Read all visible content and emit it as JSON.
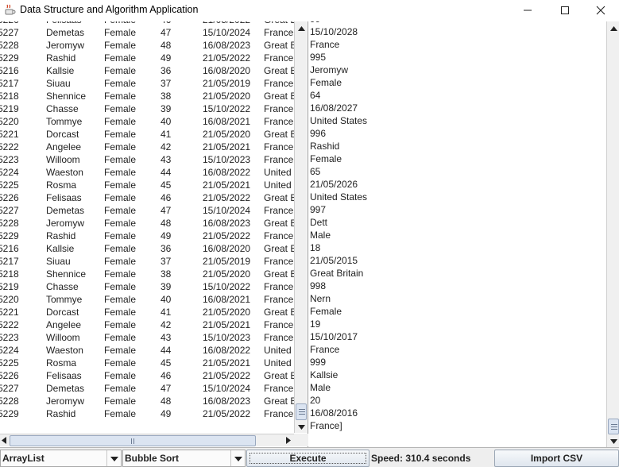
{
  "window": {
    "title": "Data Structure and Algorithm Application",
    "app_icon": "java-coffee-icon",
    "minimize_icon": "minimize-icon",
    "maximize_icon": "maximize-icon",
    "close_icon": "close-icon"
  },
  "left_table": {
    "partial_top_row": {
      "id": "5226",
      "name": "Felisaas",
      "gender": "Female",
      "age": "46",
      "date": "21/05/2022",
      "country": "Great Bri"
    },
    "rows": [
      {
        "id": "5227",
        "name": "Demetas",
        "gender": "Female",
        "age": "47",
        "date": "15/10/2024",
        "country": "France"
      },
      {
        "id": "5228",
        "name": "Jeromyw",
        "gender": "Female",
        "age": "48",
        "date": "16/08/2023",
        "country": "Great B"
      },
      {
        "id": "5229",
        "name": "Rashid",
        "gender": "Female",
        "age": "49",
        "date": "21/05/2022",
        "country": "France"
      },
      {
        "id": "5216",
        "name": "Kallsie",
        "gender": "Female",
        "age": "36",
        "date": "16/08/2020",
        "country": "Great Brit"
      },
      {
        "id": "5217",
        "name": "Siuau",
        "gender": "Female",
        "age": "37",
        "date": "21/05/2019",
        "country": "France"
      },
      {
        "id": "5218",
        "name": "Shennice",
        "gender": "Female",
        "age": "38",
        "date": "21/05/2020",
        "country": "Great B"
      },
      {
        "id": "5219",
        "name": "Chasse",
        "gender": "Female",
        "age": "39",
        "date": "15/10/2022",
        "country": "France"
      },
      {
        "id": "5220",
        "name": "Tommye",
        "gender": "Female",
        "age": "40",
        "date": "16/08/2021",
        "country": "France"
      },
      {
        "id": "5221",
        "name": "Dorcast",
        "gender": "Female",
        "age": "41",
        "date": "21/05/2020",
        "country": "Great Bri"
      },
      {
        "id": "5222",
        "name": "Angelee",
        "gender": "Female",
        "age": "42",
        "date": "21/05/2021",
        "country": "France"
      },
      {
        "id": "5223",
        "name": "Willoom",
        "gender": "Female",
        "age": "43",
        "date": "15/10/2023",
        "country": "France"
      },
      {
        "id": "5224",
        "name": "Waeston",
        "gender": "Female",
        "age": "44",
        "date": "16/08/2022",
        "country": "United S"
      },
      {
        "id": "5225",
        "name": "Rosma",
        "gender": "Female",
        "age": "45",
        "date": "21/05/2021",
        "country": "United S"
      },
      {
        "id": "5226",
        "name": "Felisaas",
        "gender": "Female",
        "age": "46",
        "date": "21/05/2022",
        "country": "Great Br"
      },
      {
        "id": "5227",
        "name": "Demetas",
        "gender": "Female",
        "age": "47",
        "date": "15/10/2024",
        "country": "France"
      },
      {
        "id": "5228",
        "name": "Jeromyw",
        "gender": "Female",
        "age": "48",
        "date": "16/08/2023",
        "country": "Great B"
      },
      {
        "id": "5229",
        "name": "Rashid",
        "gender": "Female",
        "age": "49",
        "date": "21/05/2022",
        "country": "France"
      },
      {
        "id": "5216",
        "name": "Kallsie",
        "gender": "Female",
        "age": "36",
        "date": "16/08/2020",
        "country": "Great Brit"
      },
      {
        "id": "5217",
        "name": "Siuau",
        "gender": "Female",
        "age": "37",
        "date": "21/05/2019",
        "country": "France"
      },
      {
        "id": "5218",
        "name": "Shennice",
        "gender": "Female",
        "age": "38",
        "date": "21/05/2020",
        "country": "Great B"
      },
      {
        "id": "5219",
        "name": "Chasse",
        "gender": "Female",
        "age": "39",
        "date": "15/10/2022",
        "country": "France"
      },
      {
        "id": "5220",
        "name": "Tommye",
        "gender": "Female",
        "age": "40",
        "date": "16/08/2021",
        "country": "France"
      },
      {
        "id": "5221",
        "name": "Dorcast",
        "gender": "Female",
        "age": "41",
        "date": "21/05/2020",
        "country": "Great Bri"
      },
      {
        "id": "5222",
        "name": "Angelee",
        "gender": "Female",
        "age": "42",
        "date": "21/05/2021",
        "country": "France"
      },
      {
        "id": "5223",
        "name": "Willoom",
        "gender": "Female",
        "age": "43",
        "date": "15/10/2023",
        "country": "France"
      },
      {
        "id": "5224",
        "name": "Waeston",
        "gender": "Female",
        "age": "44",
        "date": "16/08/2022",
        "country": "United S"
      },
      {
        "id": "5225",
        "name": "Rosma",
        "gender": "Female",
        "age": "45",
        "date": "21/05/2021",
        "country": "United S"
      },
      {
        "id": "5226",
        "name": "Felisaas",
        "gender": "Female",
        "age": "46",
        "date": "21/05/2022",
        "country": "Great Br"
      },
      {
        "id": "5227",
        "name": "Demetas",
        "gender": "Female",
        "age": "47",
        "date": "15/10/2024",
        "country": "France"
      },
      {
        "id": "5228",
        "name": "Jeromyw",
        "gender": "Female",
        "age": "48",
        "date": "16/08/2023",
        "country": "Great B"
      },
      {
        "id": "5229",
        "name": "Rashid",
        "gender": "Female",
        "age": "49",
        "date": "21/05/2022",
        "country": "France"
      }
    ]
  },
  "right_output": {
    "partial_top_line": "99",
    "lines": [
      "15/10/2028",
      "France",
      "995",
      "Jeromyw",
      "Female",
      "64",
      "16/08/2027",
      "United States",
      "996",
      "Rashid",
      "Female",
      "65",
      "21/05/2026",
      "United States",
      "997",
      "Dett",
      "Male",
      "18",
      "21/05/2015",
      "Great Britain",
      "998",
      "Nern",
      "Female",
      "19",
      "15/10/2017",
      "France",
      "999",
      "Kallsie",
      "Male",
      "20",
      "16/08/2016",
      "France]"
    ]
  },
  "toolbar": {
    "data_structure": "ArrayList",
    "algorithm": "Bubble Sort",
    "execute_label": "Execute",
    "speed_text": "Speed: 310.4 seconds",
    "import_label": "Import CSV"
  }
}
